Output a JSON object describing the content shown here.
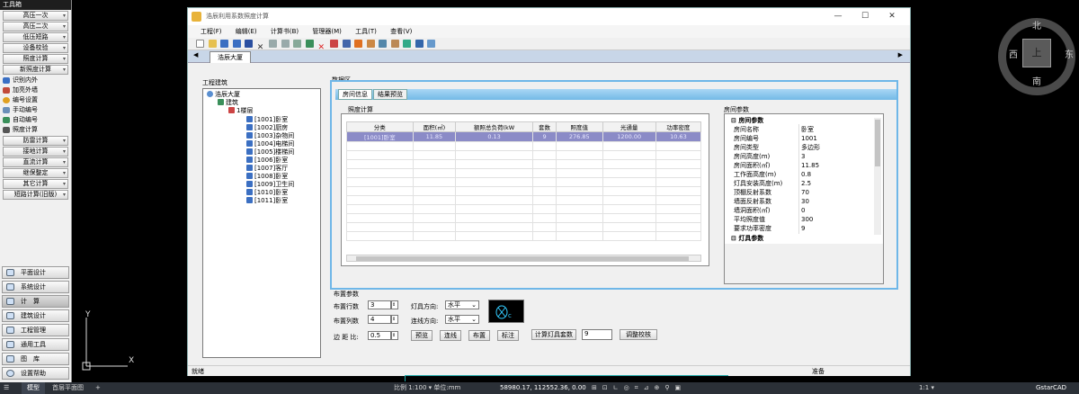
{
  "toolbox": {
    "title": "工具箱",
    "buttons": [
      "高压一次",
      "高压二次",
      "低压短路",
      "设备校验",
      "照度计算",
      "新照度计算"
    ],
    "items": [
      "识别内外",
      "加亮外墙",
      "编号设置",
      "手动编号",
      "自动编号",
      "照度计算"
    ],
    "buttons2": [
      "防雷计算",
      "接地计算",
      "直流计算",
      "继保整定",
      "其它计算",
      "短路计算(旧版)"
    ],
    "bottom": [
      "平面设计",
      "系统设计",
      "计　算",
      "建筑设计",
      "工程管理",
      "通用工具",
      "图　库",
      "设置帮助"
    ]
  },
  "window": {
    "title": "浩辰利用系数照度计算",
    "menu": [
      "工程(F)",
      "编辑(E)",
      "计算书(B)",
      "管理器(M)",
      "工具(T)",
      "查看(V)"
    ],
    "tab": "浩辰大厦",
    "status_left": "就绪",
    "status_right": "准备"
  },
  "tree": {
    "header": "工程建筑",
    "root": "浩辰大厦",
    "building": "建筑",
    "floor": "1楼层",
    "rooms": [
      "[1001]卧室",
      "[1002]厨房",
      "[1003]杂物间",
      "[1004]电梯间",
      "[1005]楼梯间",
      "[1006]卧室",
      "[1007]客厅",
      "[1008]卧室",
      "[1009]卫生间",
      "[1010]卧室",
      "[1011]卧室"
    ]
  },
  "data": {
    "header": "数据区",
    "tabs": [
      "房间信息",
      "结果预览"
    ],
    "calc_title": "照度计算",
    "columns": [
      "分类",
      "面积(㎡)",
      "额照总负荷(kW",
      "套数",
      "照度值",
      "光通量",
      "功率密度"
    ],
    "rows": [
      [
        "[1001]卧室",
        "11.85",
        "0.13",
        "9",
        "276.85",
        "1200.00",
        "10.63"
      ]
    ],
    "prop_title": "房间参数",
    "prop_group": "房间参数",
    "props": [
      [
        "房间名称",
        "卧室"
      ],
      [
        "房间编号",
        "1001"
      ],
      [
        "房间类型",
        "多边形"
      ],
      [
        "房间高度(m)",
        "3"
      ],
      [
        "房间面积(㎡)",
        "11.85"
      ],
      [
        "工作面高度(m)",
        "0.8"
      ],
      [
        "灯具安装高度(m)",
        "2.5"
      ],
      [
        "顶棚反射系数",
        "70"
      ],
      [
        "墙面反射系数",
        "30"
      ],
      [
        "墙洞面积(㎡)",
        "0"
      ],
      [
        "平均照度值",
        "300"
      ],
      [
        "要求功率密度",
        "9"
      ]
    ],
    "prop_group2": "灯具参数"
  },
  "layout": {
    "title": "布置参数",
    "rows_label": "布置行数",
    "rows_value": "3",
    "cols_label": "布置列数",
    "cols_value": "4",
    "margin_label": "边 距 比:",
    "margin_value": "0.5",
    "dir_label": "灯具方向:",
    "dir_value": "水平",
    "conn_label": "连线方向:",
    "conn_value": "水平",
    "btn_preview": "预览",
    "btn_line": "连线",
    "btn_place": "布置",
    "btn_mark": "标注",
    "calc_btn": "计算灯具套数",
    "calc_value": "9",
    "adjust_btn": "调整校核"
  },
  "compass": {
    "n": "北",
    "s": "南",
    "e": "东",
    "w": "西",
    "center": "上"
  },
  "cad": {
    "model": "模型",
    "layout": "首层平面图",
    "scale": "比例 1:100 ▾ 单位:mm",
    "coords": "58980.17, 112552.36, 0.00",
    "zoom": "1:1 ▾",
    "brand": "GstarCAD"
  },
  "axis": {
    "y": "Y",
    "x": "X"
  }
}
